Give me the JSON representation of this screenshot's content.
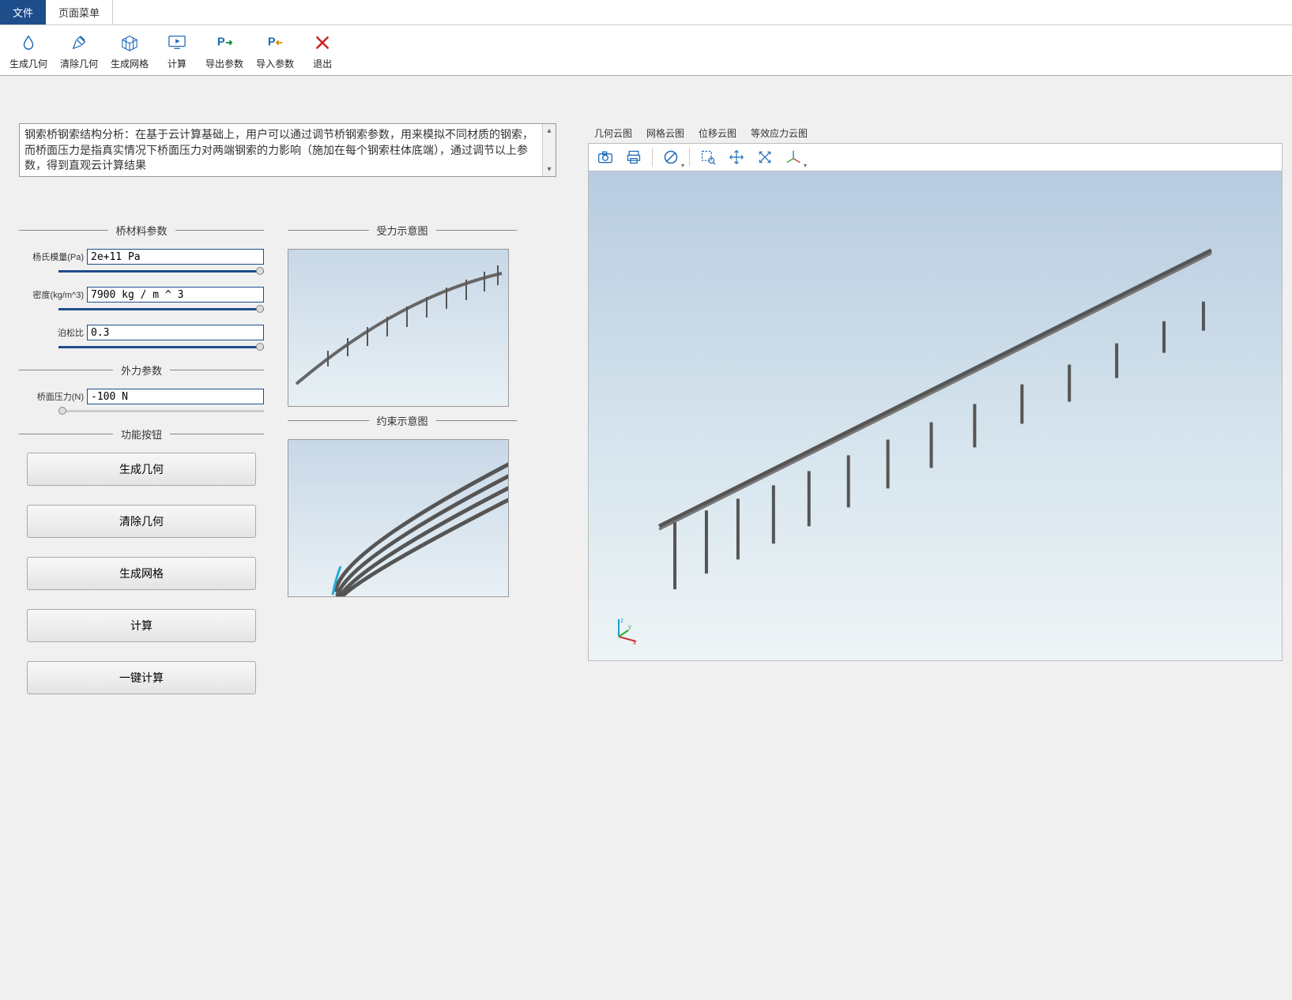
{
  "tabs": {
    "file": "文件",
    "page_menu": "页面菜单"
  },
  "ribbon": {
    "gen_geometry": "生成几何",
    "clear_geometry": "清除几何",
    "gen_mesh": "生成网格",
    "compute": "计算",
    "export_params": "导出参数",
    "import_params": "导入参数",
    "exit": "退出"
  },
  "description": "钢索桥钢索结构分析：在基于云计算基础上，用户可以通过调节桥钢索参数，用来模拟不同材质的钢索，而桥面压力是指真实情况下桥面压力对两端钢索的力影响（施加在每个钢索柱体底端），通过调节以上参数，得到直观云计算结果",
  "sections": {
    "material": "桥材料参数",
    "force_diagram": "受力示意图",
    "external_force": "外力参数",
    "constraint_diagram": "约束示意图",
    "actions": "功能按钮"
  },
  "params": {
    "youngs_modulus_label": "杨氏模量(Pa)",
    "youngs_modulus_value": "2e+11 Pa",
    "density_label": "密度(kg/m^3)",
    "density_value": "7900 kg / m ^ 3",
    "poisson_label": "泊松比",
    "poisson_value": "0.3",
    "surface_pressure_label": "桥面压力(N)",
    "surface_pressure_value": "-100 N"
  },
  "buttons": {
    "gen_geometry": "生成几何",
    "clear_geometry": "清除几何",
    "gen_mesh": "生成网格",
    "compute": "计算",
    "one_click_compute": "一键计算"
  },
  "view_tabs": {
    "geometry": "几何云图",
    "mesh": "网格云图",
    "displacement": "位移云图",
    "stress": "等效应力云图"
  },
  "axis": {
    "x": "x",
    "y": "y",
    "z": "z"
  }
}
